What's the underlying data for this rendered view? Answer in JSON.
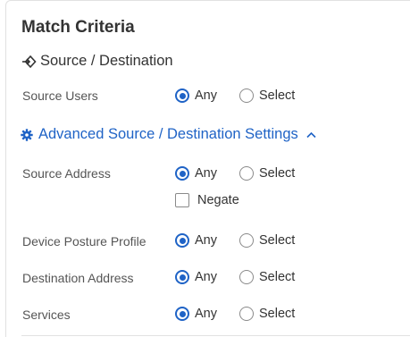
{
  "section": {
    "title": "Match Criteria",
    "subheading": "Source / Destination"
  },
  "rows": {
    "source_users": {
      "label": "Source Users",
      "any": "Any",
      "select": "Select",
      "selected": "any"
    },
    "source_address": {
      "label": "Source Address",
      "any": "Any",
      "select": "Select",
      "selected": "any",
      "negate": "Negate",
      "negate_checked": false
    },
    "device_posture": {
      "label": "Device Posture Profile",
      "any": "Any",
      "select": "Select",
      "selected": "any"
    },
    "destination_address": {
      "label": "Destination Address",
      "any": "Any",
      "select": "Select",
      "selected": "any"
    },
    "services": {
      "label": "Services",
      "any": "Any",
      "select": "Select",
      "selected": "any"
    }
  },
  "advanced": {
    "label": "Advanced Source / Destination Settings",
    "expanded": true
  },
  "colors": {
    "accent": "#1f63c6",
    "text": "#333333",
    "muted_label": "#555555",
    "border": "#e1e1e1"
  }
}
